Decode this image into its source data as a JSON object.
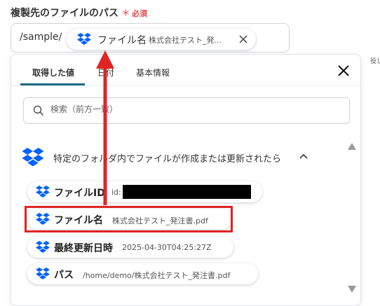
{
  "field": {
    "label": "複製先のファイルのパス",
    "required_mark": "＊",
    "required_text": "必須"
  },
  "path_input": {
    "prefix": "/sample/",
    "chip": {
      "name": "ファイル名",
      "value": "株式会社テスト_発..."
    }
  },
  "edge_text": "役して",
  "panel": {
    "tabs": [
      {
        "label": "取得した値",
        "active": true
      },
      {
        "label": "日付",
        "active": false
      },
      {
        "label": "基本情報",
        "active": false
      }
    ],
    "search": {
      "placeholder": "検索（前方一致）",
      "value": ""
    },
    "section": {
      "title": "特定のフォルダ内でファイルが作成または更新されたら",
      "expanded": true
    },
    "items": [
      {
        "name": "ファイルID",
        "value": "id:"
      },
      {
        "name": "ファイル名",
        "value": "株式会社テスト_発注書.pdf"
      },
      {
        "name": "最終更新日時",
        "value": "2025-04-30T04:25:27Z"
      },
      {
        "name": "パス",
        "value": "/home/demo/株式会社テスト_発注書.pdf"
      }
    ]
  },
  "colors": {
    "accent": "#1e6b86",
    "required": "#e8464e",
    "annotation": "#e02424",
    "dropbox": "#0061fe"
  },
  "icons": [
    "dropbox-icon",
    "close-icon",
    "search-icon",
    "chevron-up-icon",
    "scroll-up-icon",
    "scroll-down-icon"
  ]
}
